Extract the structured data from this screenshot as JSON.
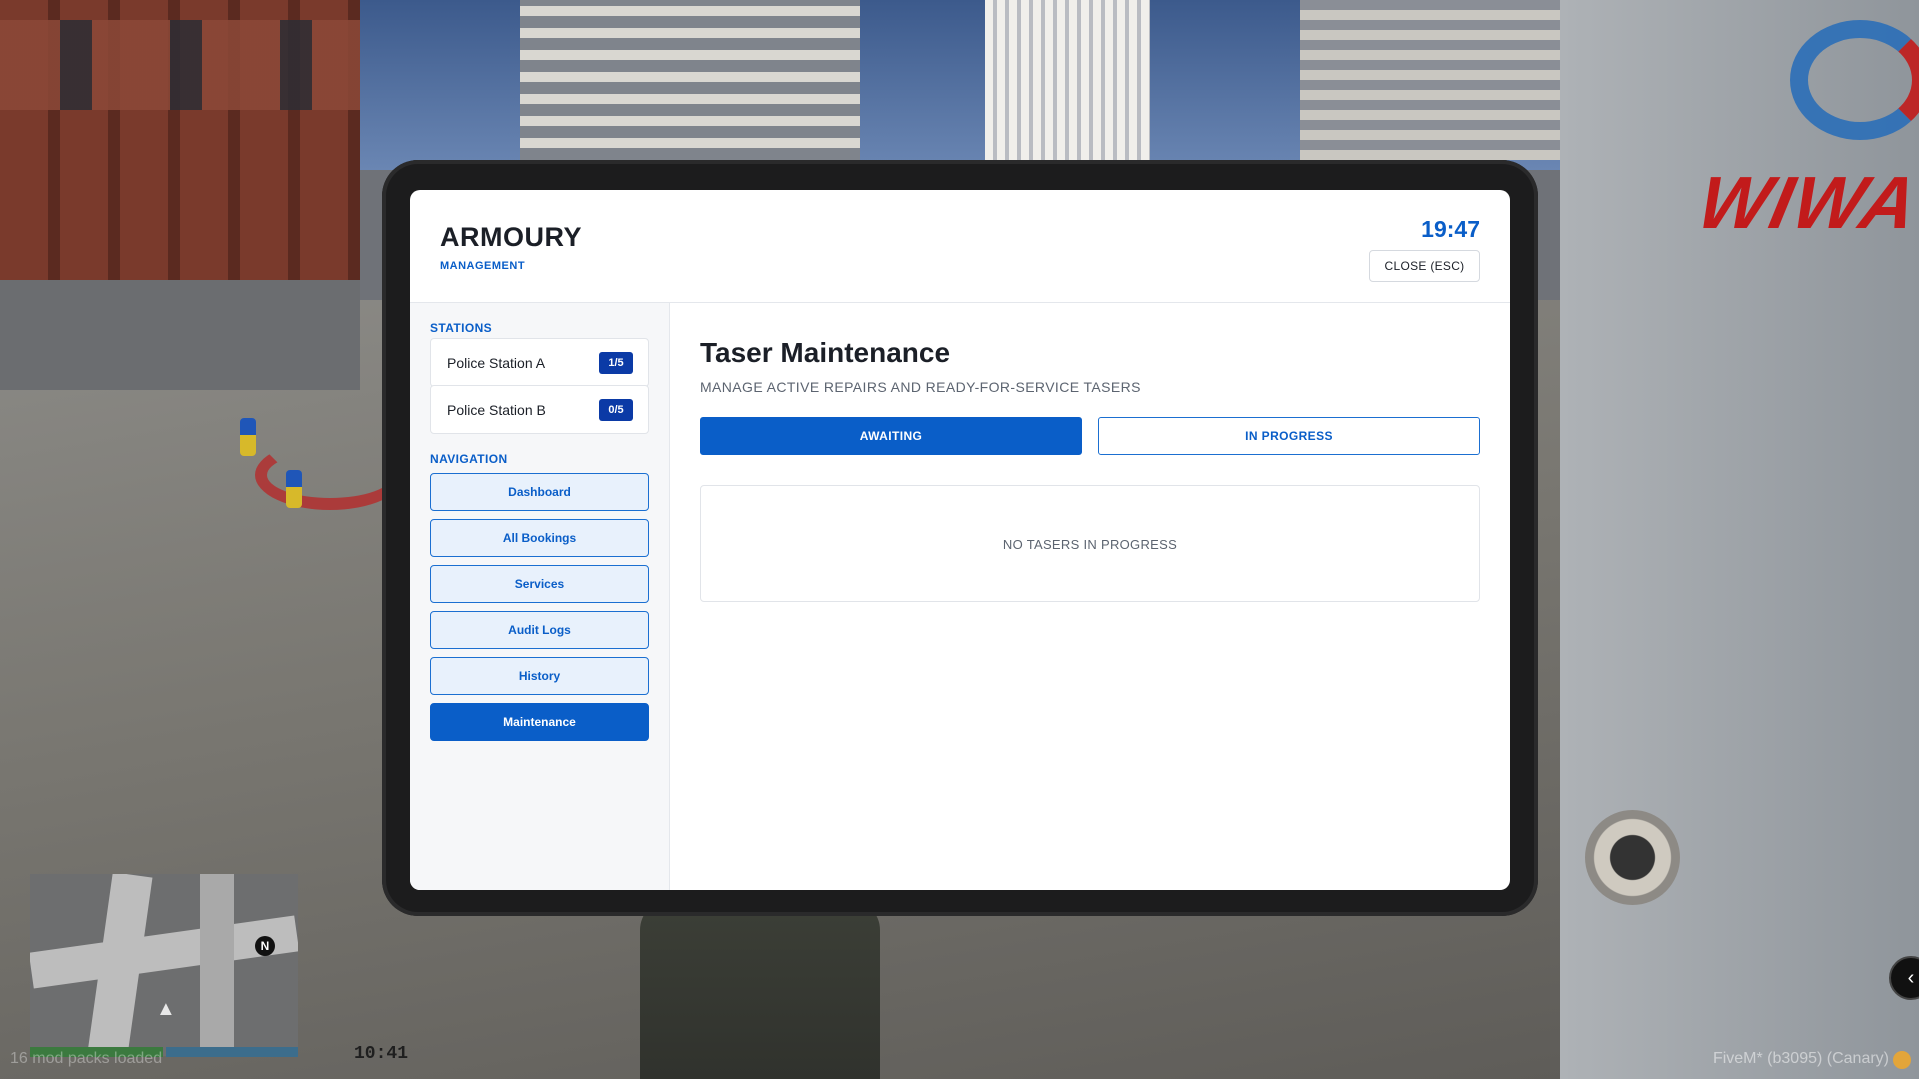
{
  "app": {
    "title": "ARMOURY",
    "subtitle": "MANAGEMENT",
    "clock": "19:47",
    "close_label": "CLOSE (ESC)"
  },
  "sidebar": {
    "stations_label": "STATIONS",
    "stations": [
      {
        "name": "Police Station A",
        "count": "1/5"
      },
      {
        "name": "Police Station B",
        "count": "0/5"
      }
    ],
    "navigation_label": "NAVIGATION",
    "nav": [
      {
        "label": "Dashboard",
        "active": false
      },
      {
        "label": "All Bookings",
        "active": false
      },
      {
        "label": "Services",
        "active": false
      },
      {
        "label": "Audit Logs",
        "active": false
      },
      {
        "label": "History",
        "active": false
      },
      {
        "label": "Maintenance",
        "active": true
      }
    ]
  },
  "main": {
    "title": "Taser Maintenance",
    "subtitle": "MANAGE ACTIVE REPAIRS AND READY-FOR-SERVICE TASERS",
    "tabs": [
      {
        "label": "AWAITING",
        "active": true
      },
      {
        "label": "IN PROGRESS",
        "active": false
      }
    ],
    "empty_message": "NO TASERS IN PROGRESS"
  },
  "hud": {
    "mod_packs": "16 mod packs loaded",
    "game_clock": "10:41",
    "client_version": "FiveM* (b3095) (Canary)",
    "minimap_north": "N",
    "billboard_text": "WIWA"
  },
  "colors": {
    "accent": "#0a5ec8",
    "badge": "#0b3aa6",
    "text": "#1b1f27",
    "muted": "#5c6470"
  },
  "icons": {
    "minimap_player": "player-arrow-icon",
    "client": "fivem-icon",
    "side_button": "chevron-left-icon"
  }
}
